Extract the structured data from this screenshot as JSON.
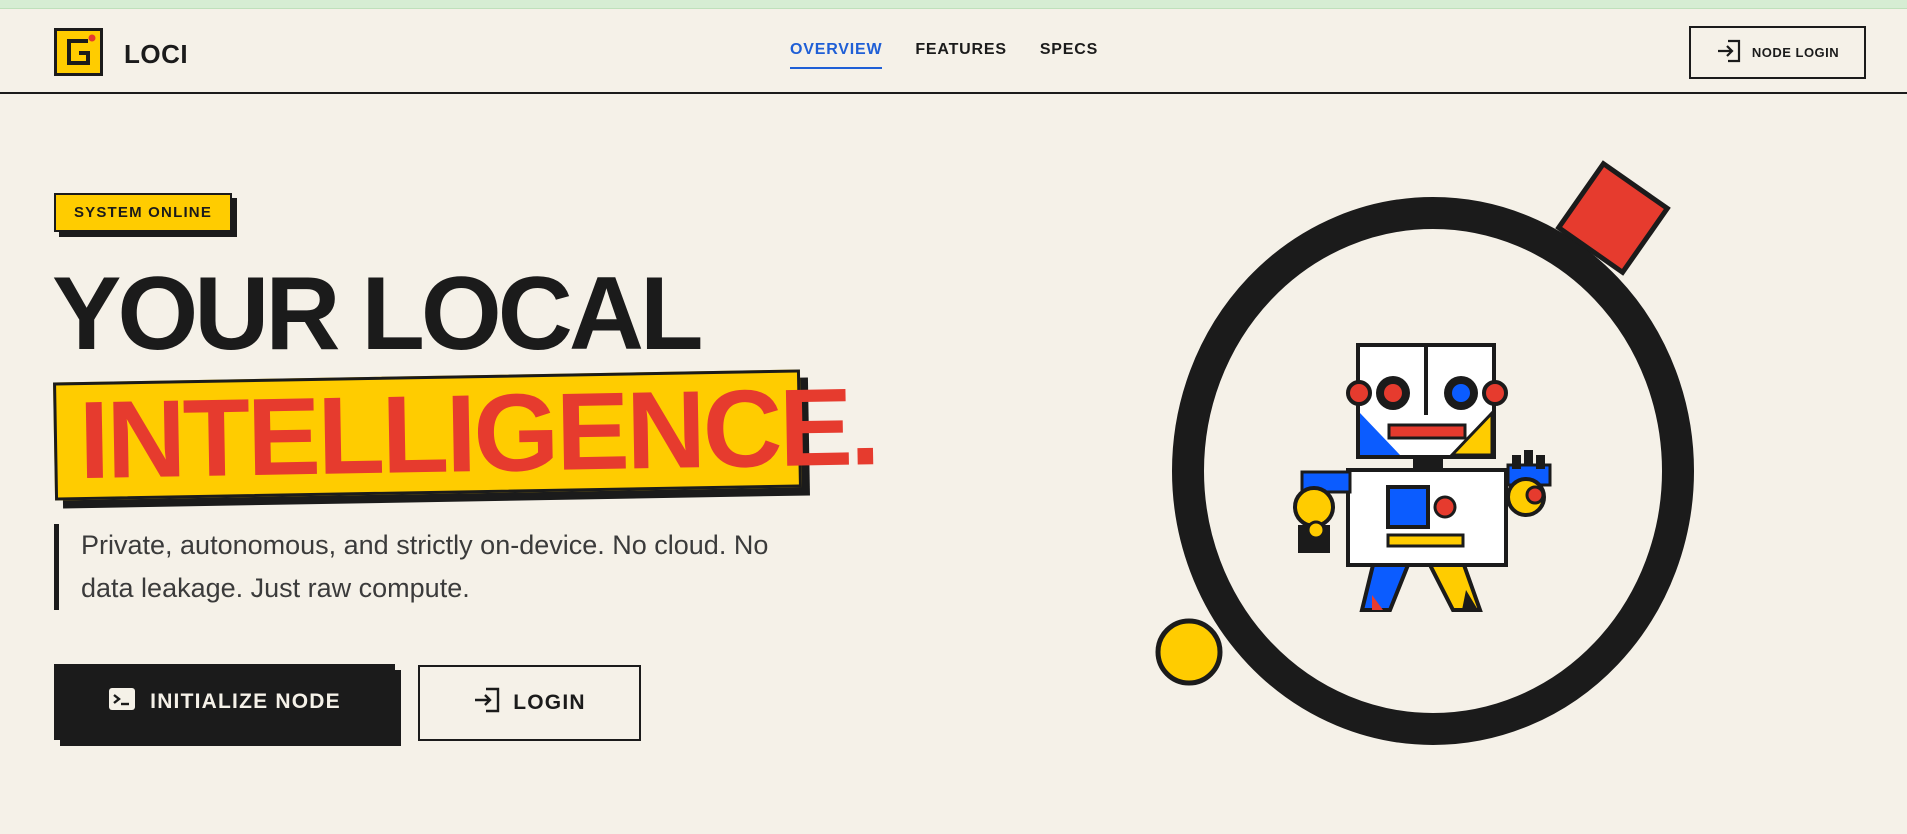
{
  "header": {
    "brand": "LOCI",
    "nav": [
      {
        "label": "OVERVIEW",
        "active": true
      },
      {
        "label": "FEATURES",
        "active": false
      },
      {
        "label": "SPECS",
        "active": false
      }
    ],
    "node_login_label": "NODE LOGIN"
  },
  "hero": {
    "badge": "SYSTEM ONLINE",
    "headline_line1": "YOUR LOCAL",
    "headline_line2": "INTELLIGENCE.",
    "description": "Private, autonomous, and strictly on-device. No cloud. No data leakage. Just raw compute.",
    "primary_button": "INITIALIZE NODE",
    "secondary_button": "LOGIN"
  },
  "icons": {
    "logo": "loci-logo-icon",
    "login": "login-arrow-icon",
    "terminal": "terminal-icon"
  },
  "colors": {
    "background": "#f5f1e8",
    "ink": "#1b1b1b",
    "yellow": "#ffcc00",
    "red": "#e63b2e",
    "blue": "#0b5cff",
    "nav_active": "#1f5fd6"
  }
}
